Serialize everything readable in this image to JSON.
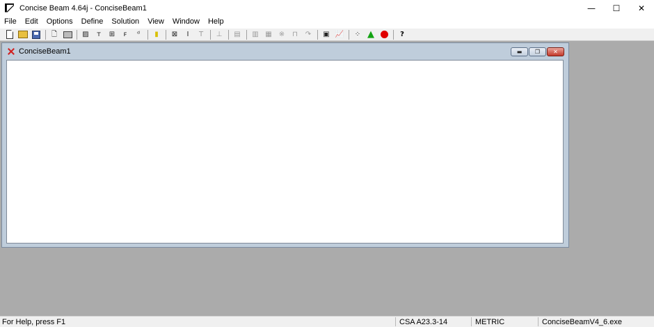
{
  "window": {
    "title": "Concise Beam 4.64j - ConciseBeam1",
    "minimize": "—",
    "maximize": "☐",
    "close": "✕"
  },
  "menu": [
    "File",
    "Edit",
    "Options",
    "Define",
    "Solution",
    "View",
    "Window",
    "Help"
  ],
  "toolbar": {
    "buttons": [
      {
        "name": "new-file-icon",
        "glyph": ""
      },
      {
        "name": "open-folder-icon",
        "glyph": ""
      },
      {
        "name": "save-disk-icon",
        "glyph": ""
      },
      {
        "name": "print-preview-icon",
        "glyph": "🗋"
      },
      {
        "name": "print-icon",
        "glyph": ""
      },
      {
        "name": "beam-icon",
        "glyph": "▨"
      },
      {
        "name": "moment-icon",
        "glyph": "ᴛ"
      },
      {
        "name": "loads-icon",
        "glyph": "⊞"
      },
      {
        "name": "to-in-icon",
        "glyph": "ꜰ"
      },
      {
        "name": "dt-icon",
        "glyph": "ᵈ"
      },
      {
        "name": "highlight-icon",
        "glyph": "▮"
      },
      {
        "name": "section-icon",
        "glyph": "⊠"
      },
      {
        "name": "i-beam-icon",
        "glyph": "I"
      },
      {
        "name": "t-section-icon",
        "glyph": "T"
      },
      {
        "name": "support-icon",
        "glyph": "⊥"
      },
      {
        "name": "report-icon",
        "glyph": "▤"
      },
      {
        "name": "compare-icon",
        "glyph": "▥"
      },
      {
        "name": "rebar-icon",
        "glyph": "▦"
      },
      {
        "name": "crush-icon",
        "glyph": "※"
      },
      {
        "name": "stirrup-icon",
        "glyph": "⊓"
      },
      {
        "name": "hook-icon",
        "glyph": "↷"
      },
      {
        "name": "table-icon",
        "glyph": "▣"
      },
      {
        "name": "graph-icon",
        "glyph": "📈"
      },
      {
        "name": "grid-icon",
        "glyph": "⁘"
      },
      {
        "name": "tree-icon",
        "glyph": "▲"
      },
      {
        "name": "stop-icon",
        "glyph": ""
      },
      {
        "name": "context-help-icon",
        "glyph": "?"
      }
    ]
  },
  "child_window": {
    "title": "ConciseBeam1",
    "minimize": "▬",
    "restore": "❐",
    "close": "✕"
  },
  "status": {
    "help": "For Help, press F1",
    "code": "CSA A23.3-14",
    "units": "METRIC",
    "exe": "ConciseBeamV4_6.exe"
  }
}
